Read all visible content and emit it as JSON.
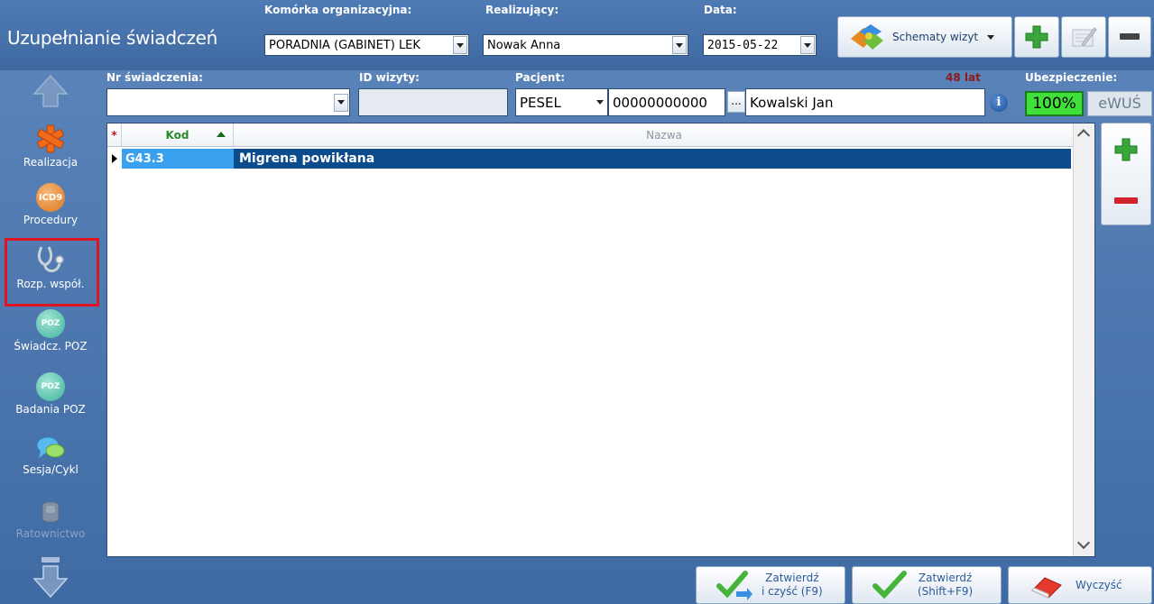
{
  "header": {
    "title": "Uzupełnianie świadczeń",
    "komorka": {
      "label": "Komórka organizacyjna:",
      "value": "PORADNIA (GABINET) LEK"
    },
    "realizujacy": {
      "label": "Realizujący:",
      "value": "Nowak Anna"
    },
    "data": {
      "label": "Data:",
      "value": "2015-05-22"
    },
    "schematy_label": "Schematy wizyt"
  },
  "form": {
    "nr_label": "Nr świadczenia:",
    "nr_value": "",
    "id_wizyty_label": "ID wizyty:",
    "id_wizyty_value": "",
    "pacjent_label": "Pacjent:",
    "age": "48 lat",
    "id_type": "PESEL",
    "pesel": "00000000000",
    "more": "...",
    "patient_name": "Kowalski Jan",
    "ubezpieczenie_label": "Ubezpieczenie:",
    "insurance_pct": "100%",
    "ewus": "eWUŚ"
  },
  "sidebar": {
    "items": [
      {
        "label": "Realizacja",
        "icon": "asterisk-medical-icon"
      },
      {
        "label": "Procedury",
        "icon": "icd9-icon",
        "badge": "ICD9"
      },
      {
        "label": "Rozp. współ.",
        "icon": "stethoscope-icon"
      },
      {
        "label": "Świadcz. POZ",
        "icon": "poz-icon",
        "badge": "POZ"
      },
      {
        "label": "Badania POZ",
        "icon": "poz-tools-icon",
        "badge": "POZ"
      },
      {
        "label": "Sesja/Cykl",
        "icon": "chat-bubbles-icon"
      },
      {
        "label": "Ratownictwo",
        "icon": "ratownictwo-icon"
      }
    ]
  },
  "grid": {
    "col_star": "*",
    "col_kod": "Kod",
    "col_nazwa": "Nazwa",
    "rows": [
      {
        "kod": "G43.3",
        "nazwa": "Migrena powikłana"
      }
    ]
  },
  "buttons": {
    "zatwierdz_czysc_l1": "Zatwierdź",
    "zatwierdz_czysc_l2": "i czyść (F9)",
    "zatwierdz_shift_l1": "Zatwierdź",
    "zatwierdz_shift_l2": "(Shift+F9)",
    "wyczysc": "Wyczyść"
  },
  "colors": {
    "accent_green": "#2ea82e",
    "row_selected": "#0c4c8d",
    "age_red": "#8b1a1a",
    "active_item_border": "#e0141e"
  }
}
